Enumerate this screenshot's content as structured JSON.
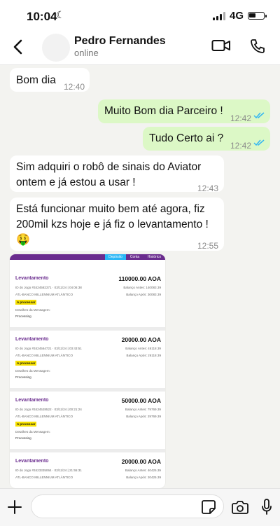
{
  "status": {
    "time": "10:04",
    "network": "4G"
  },
  "header": {
    "name": "Pedro Fernandes",
    "status": "online"
  },
  "messages": [
    {
      "dir": "in",
      "text": "Bom dia",
      "time": "12:40"
    },
    {
      "dir": "out",
      "text": "Muito Bom dia Parceiro !",
      "time": "12:42"
    },
    {
      "dir": "out",
      "text": "Tudo Certo ai ?",
      "time": "12:42"
    },
    {
      "dir": "in",
      "lines": [
        "Sim adquiri o robô de sinais do Aviator",
        "ontem e já estou a usar !"
      ],
      "time": "12:43"
    },
    {
      "dir": "in",
      "lines": [
        "Está funcionar muito bem até agora, fiz",
        "200mil kzs hoje e já fiz o levantamento !"
      ],
      "emoji": "🤑",
      "time": "12:55"
    }
  ],
  "screenshot": {
    "tabs": [
      "Depósito",
      "Conta",
      "Histórico"
    ],
    "transactions": [
      {
        "title": "Levantamento",
        "amount": "110000.00 AOA",
        "game_id": "ID do Jogo #3424582371 · 03/11/24 | 04:06:38",
        "bank": "ATL-BANCO MILLENNIUM ATLÂNTICO",
        "balance_before": "Balanço Antes: 140083.39",
        "balance_after": "Balanço Após: 30083.39",
        "status": "A processar",
        "details_label": "Detalhes da Mensagem:",
        "details": "Processing"
      },
      {
        "title": "Levantamento",
        "amount": "20000.00 AOA",
        "game_id": "ID do Jogo #3424564721 · 03/11/24 | 03:43:51",
        "bank": "ATL-BANCO MILLENNIUM ATLÂNTICO",
        "balance_before": "Balanço Antes: 46118.39",
        "balance_after": "Balanço Após: 26118.39",
        "status": "A processar",
        "details_label": "Detalhes da Mensagem:",
        "details": "Processing"
      },
      {
        "title": "Levantamento",
        "amount": "50000.00 AOA",
        "game_id": "ID do Jogo #3424528522 · 03/11/24 | 00:21:24",
        "bank": "ATL-BANCO MILLENNIUM ATLÂNTICO",
        "balance_before": "Balanço Antes: 79769.39",
        "balance_after": "Balanço Após: 29769.39",
        "status": "A processar",
        "details_label": "Detalhes da Mensagem:",
        "details": "Processing"
      },
      {
        "title": "Levantamento",
        "amount": "20000.00 AOA",
        "game_id": "ID do Jogo #3423335064 · 02/11/24 | 21:55:31",
        "bank": "ATL-BANCO MILLENNIUM ATLÂNTICO",
        "balance_before": "Balanço Antes: 40425.39",
        "balance_after": "Balanço Após: 20425.39"
      }
    ]
  },
  "input": {
    "placeholder": ""
  },
  "colors": {
    "outgoing": "#dcf8c6",
    "incoming": "#ffffff",
    "read_ticks": "#34b7f1",
    "brand_purple": "#6a2c8e",
    "badge_yellow": "#f6e000"
  }
}
